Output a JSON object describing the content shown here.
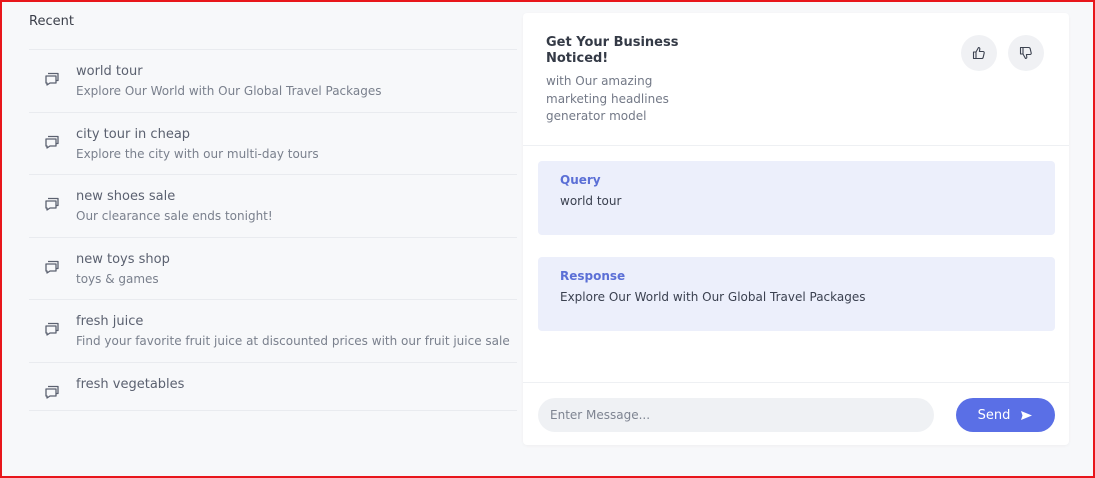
{
  "recent": {
    "title": "Recent",
    "items": [
      {
        "title": "world tour",
        "desc": "Explore Our World with Our Global Travel Packages"
      },
      {
        "title": "city tour in cheap",
        "desc": "Explore the city with our multi-day tours"
      },
      {
        "title": "new shoes sale",
        "desc": "Our clearance sale ends tonight!"
      },
      {
        "title": "new toys shop",
        "desc": "toys & games"
      },
      {
        "title": "fresh juice",
        "desc": "Find your favorite fruit juice at discounted prices with our fruit juice sale"
      },
      {
        "title": "fresh vegetables",
        "desc": ""
      }
    ],
    "item_icon": "chat-bubbles-icon"
  },
  "card": {
    "title": "Get Your Business Noticed!",
    "subtitle": "with Our amazing marketing headlines generator model",
    "like_icon": "thumbs-up-icon",
    "dislike_icon": "thumbs-down-icon"
  },
  "query": {
    "label": "Query",
    "text": "world tour"
  },
  "response": {
    "label": "Response",
    "text": "Explore Our World with Our Global Travel Packages"
  },
  "composer": {
    "placeholder": "Enter Message...",
    "send_label": "Send",
    "send_icon": "send-arrow-icon"
  },
  "colors": {
    "accent": "#5a6fe6",
    "block_bg": "#eceffb",
    "label": "#5b6fd6",
    "frame": "#e8161b"
  }
}
